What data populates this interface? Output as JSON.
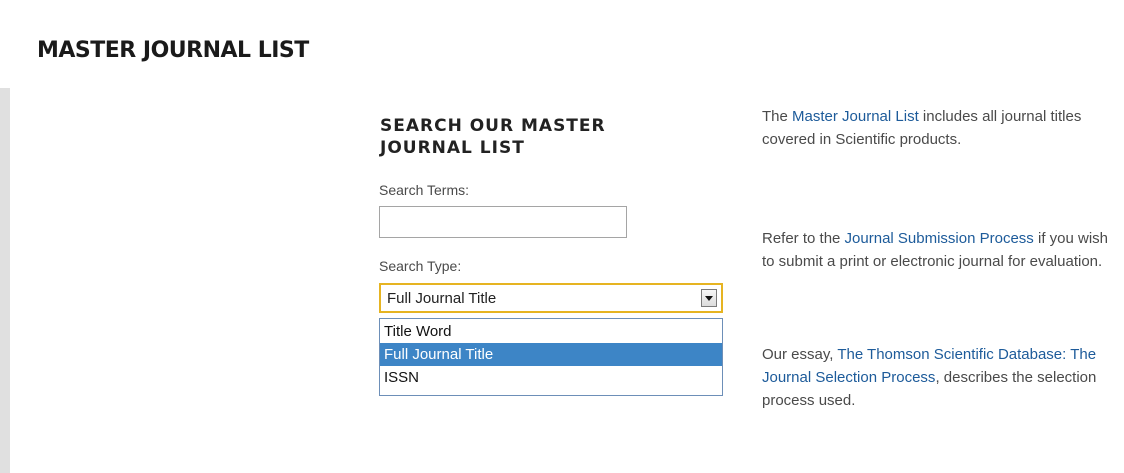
{
  "page": {
    "title": "MASTER JOURNAL LIST"
  },
  "search": {
    "heading": "SEARCH OUR MASTER JOURNAL LIST",
    "terms_label": "Search Terms:",
    "terms_value": "",
    "type_label": "Search Type:",
    "type_selected": "Full Journal Title",
    "type_options": [
      "Title Word",
      "Full Journal Title",
      "ISSN"
    ]
  },
  "info": {
    "p1": {
      "before": "The ",
      "link": "Master Journal List",
      "after": " includes all journal titles covered in Scientific products."
    },
    "p2": {
      "before": "Refer to the ",
      "link": "Journal Submission Process",
      "after": " if you wish to submit a print or electronic journal for evaluation."
    },
    "p3": {
      "before": "Our essay, ",
      "link": "The Thomson Scientific Database: The Journal Selection Process",
      "after": ", describes the selection process used."
    }
  },
  "colors": {
    "link": "#1d5b9a",
    "selected_option_bg": "#3d85c6",
    "select_focus_border": "#e6b422"
  }
}
